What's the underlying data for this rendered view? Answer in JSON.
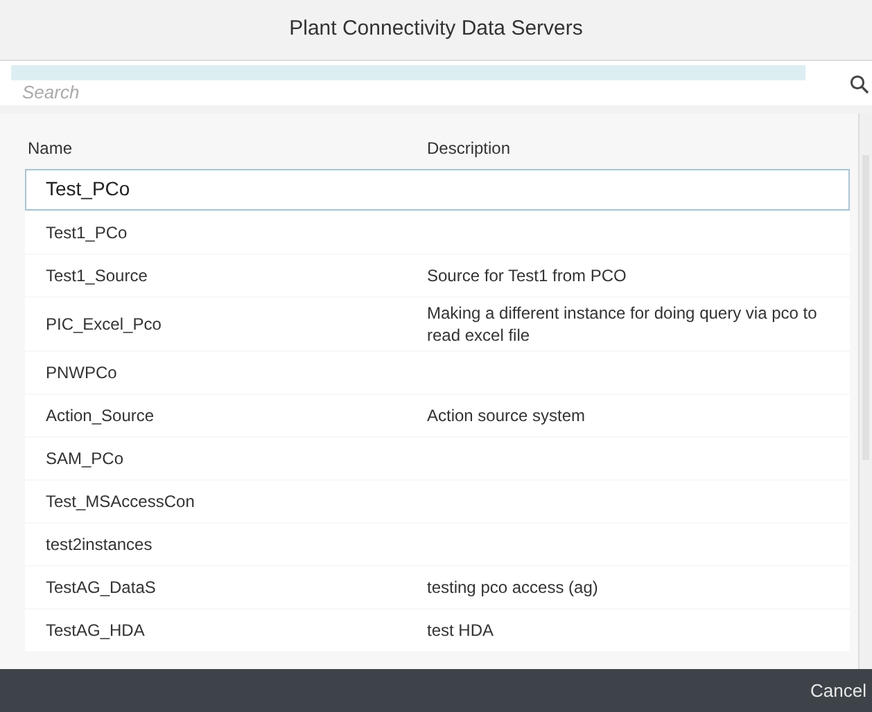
{
  "dialog": {
    "title": "Plant Connectivity Data Servers"
  },
  "search": {
    "placeholder": "Search"
  },
  "table": {
    "columns": [
      "Name",
      "Description"
    ],
    "rows": [
      {
        "name": "Test_PCo",
        "description": "",
        "selected": true
      },
      {
        "name": "Test1_PCo",
        "description": "",
        "selected": false
      },
      {
        "name": "Test1_Source",
        "description": "Source for Test1 from PCO",
        "selected": false
      },
      {
        "name": "PIC_Excel_Pco",
        "description": "Making a different instance for doing query via pco to read excel file",
        "selected": false
      },
      {
        "name": "PNWPCo",
        "description": "",
        "selected": false
      },
      {
        "name": "Action_Source",
        "description": "Action source system",
        "selected": false
      },
      {
        "name": "SAM_PCo",
        "description": "",
        "selected": false
      },
      {
        "name": "Test_MSAccessCon",
        "description": "",
        "selected": false
      },
      {
        "name": "test2instances",
        "description": "",
        "selected": false
      },
      {
        "name": "TestAG_DataS",
        "description": "testing pco access (ag)",
        "selected": false
      },
      {
        "name": "TestAG_HDA",
        "description": "test HDA",
        "selected": false
      }
    ]
  },
  "footer": {
    "buttons": [
      "Cancel"
    ]
  }
}
